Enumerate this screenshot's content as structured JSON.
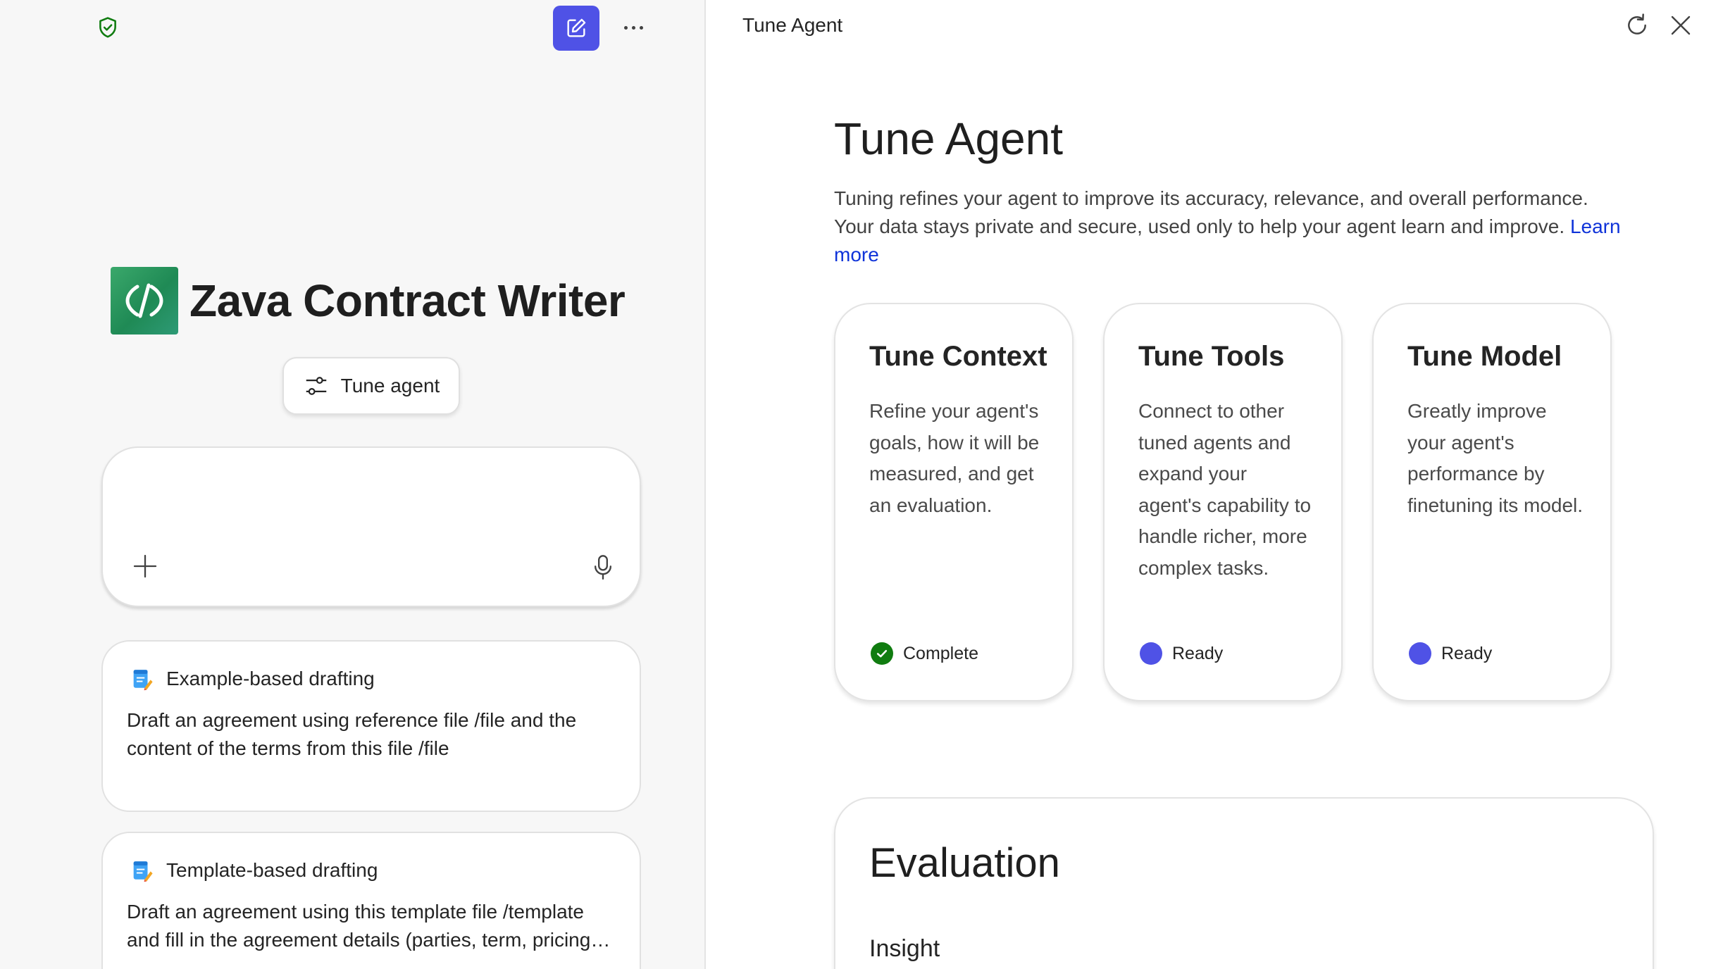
{
  "left": {
    "agent_name": "Zava Contract Writer",
    "tune_button_label": "Tune agent",
    "composer": {
      "placeholder": ""
    },
    "prompt_cards": [
      {
        "title": "Example-based drafting",
        "body": "Draft an agreement using reference file /file and the content of the terms from this file /file"
      },
      {
        "title": "Template-based drafting",
        "body": "Draft an agreement using this template file /template and fill in the agreement details (parties, term, pricing, and other details)"
      }
    ]
  },
  "panel": {
    "title": "Tune Agent",
    "heading": "Tune Agent",
    "description": "Tuning refines your agent to improve its accuracy, relevance, and overall performance. Your data stays private and secure, used only to help your agent learn and improve.",
    "learn_more": "Learn more",
    "cards": [
      {
        "title": "Tune Context",
        "description": "Refine your agent's goals, how it will be measured, and get an evaluation.",
        "status": "Complete",
        "status_color": "#107c10"
      },
      {
        "title": "Tune Tools",
        "description": "Connect to other tuned agents and expand your agent's capability to handle richer, more complex tasks.",
        "status": "Ready",
        "status_color": "#4f52e6"
      },
      {
        "title": "Tune Model",
        "description": "Greatly improve your agent's performance by finetuning its model.",
        "status": "Ready",
        "status_color": "#4f52e6"
      }
    ],
    "evaluation": {
      "title": "Evaluation",
      "subtitle": "Insight"
    }
  },
  "colors": {
    "accent": "#4f52e6",
    "success": "#107c10",
    "link": "#0f33d9"
  }
}
